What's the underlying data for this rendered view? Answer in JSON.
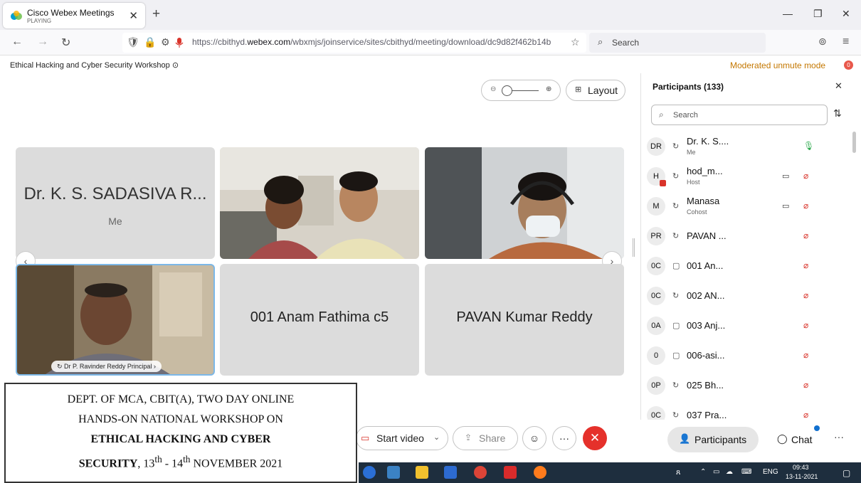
{
  "browser": {
    "tab_title": "Cisco Webex Meetings",
    "tab_status": "PLAYING",
    "url_prefix": "https://cbithyd.",
    "url_domain": "webex.com",
    "url_rest": "/wbxmjs/joinservice/sites/cbithyd/meeting/download/dc9d82f462b14b",
    "search_label": "Search"
  },
  "meeting": {
    "title": "Ethical Hacking and Cyber Security Workshop ⊙",
    "unmute_mode": "Moderated unmute mode",
    "unmute_badge": "0"
  },
  "stage": {
    "layout_label": "Layout",
    "tiles": [
      {
        "name": "Dr. K. S. SADASIVA R...",
        "sub": "Me"
      },
      {
        "name": "001 Anam Fathima c5"
      },
      {
        "name": "PAVAN Kumar Reddy"
      }
    ],
    "video_label": "Dr P. Ravinder Reddy Principal"
  },
  "controls": {
    "start_video": "Start video",
    "share": "Share"
  },
  "caption": {
    "line1": "DEPT. OF MCA, CBIT(A), TWO DAY ONLINE",
    "line2": "HANDS-ON NATIONAL WORKSHOP ON",
    "line3": "ETHICAL HACKING AND CYBER",
    "line4_bold": "SECURITY",
    "line4_a": ", 13",
    "line4_sup1": "th",
    "line4_b": "  - 14",
    "line4_sup2": "th",
    "line4_c": "  NOVEMBER 2021"
  },
  "participants": {
    "header": "Participants (133)",
    "search_placeholder": "Search",
    "list": [
      {
        "initials": "DR",
        "name": "Dr. K. S....",
        "role": "Me",
        "mic": "on",
        "camera": false,
        "device": "sync"
      },
      {
        "initials": "H",
        "name": "hod_m...",
        "role": "Host",
        "mic": "muted",
        "camera": true,
        "device": "sync",
        "badge": true
      },
      {
        "initials": "M",
        "name": "Manasa",
        "role": "Cohost",
        "mic": "muted",
        "camera": true,
        "device": "sync"
      },
      {
        "initials": "PR",
        "name": "PAVAN ...",
        "role": "",
        "mic": "muted",
        "camera": false,
        "device": "sync"
      },
      {
        "initials": "0C",
        "name": "001 An...",
        "role": "",
        "mic": "muted",
        "camera": false,
        "device": "phone"
      },
      {
        "initials": "0C",
        "name": "002 AN...",
        "role": "",
        "mic": "muted",
        "camera": false,
        "device": "sync"
      },
      {
        "initials": "0A",
        "name": "003 Anj...",
        "role": "",
        "mic": "muted",
        "camera": false,
        "device": "phone"
      },
      {
        "initials": "0",
        "name": "006-asi...",
        "role": "",
        "mic": "muted",
        "camera": false,
        "device": "phone"
      },
      {
        "initials": "0P",
        "name": "025 Bh...",
        "role": "",
        "mic": "muted",
        "camera": false,
        "device": "sync"
      },
      {
        "initials": "0C",
        "name": "037 Pra...",
        "role": "",
        "mic": "muted",
        "camera": false,
        "device": "sync"
      }
    ],
    "btn_participants": "Participants",
    "btn_chat": "Chat"
  },
  "taskbar": {
    "lang": "ENG",
    "time": "09:43",
    "date": "13-11-2021"
  },
  "colors": {
    "accent": "#1170cf",
    "end_call": "#e5312b",
    "unmute_text": "#c47700",
    "muted_mic": "#d9342b",
    "active_mic": "#2aa84a"
  }
}
